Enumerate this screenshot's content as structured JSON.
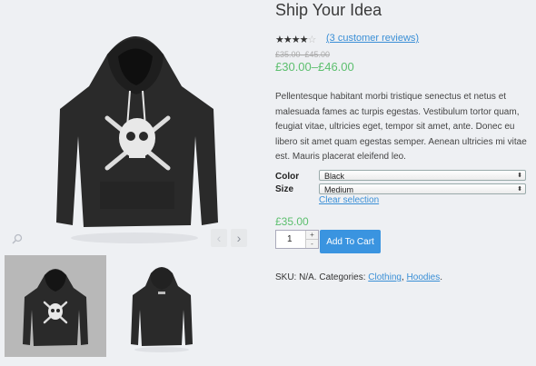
{
  "product": {
    "title": "Ship Your Idea",
    "rating_stars": 4,
    "rating_max": 5,
    "reviews_link": "(3 customer reviews)",
    "old_price": "£35.00–£45.00",
    "price": "£30.00–£46.00",
    "description": "Pellentesque habitant morbi tristique senectus et netus et malesuada fames ac turpis egestas. Vestibulum tortor quam, feugiat vitae, ultricies eget, tempor sit amet, ante. Donec eu libero sit amet quam egestas semper. Aenean ultricies mi vitae est. Mauris placerat eleifend leo."
  },
  "variations": {
    "color_label": "Color",
    "color_value": "Black",
    "size_label": "Size",
    "size_value": "Medium",
    "clear_label": "Clear selection",
    "variation_price": "£35.00"
  },
  "cart": {
    "quantity": "1",
    "plus": "+",
    "minus": "-",
    "button_label": "Add To Cart"
  },
  "meta": {
    "sku_text": "SKU: N/A. Categories: ",
    "category_1": "Clothing",
    "separator": ", ",
    "category_2": "Hoodies",
    "end": "."
  },
  "gallery": {
    "zoom_icon": "magnify-icon",
    "prev_arrow": "‹",
    "next_arrow": "›"
  },
  "colors": {
    "accent": "#3a94e0",
    "price_green": "#5cbf6e",
    "link": "#3a8fd6",
    "hoodie": "#2a2a2a"
  }
}
